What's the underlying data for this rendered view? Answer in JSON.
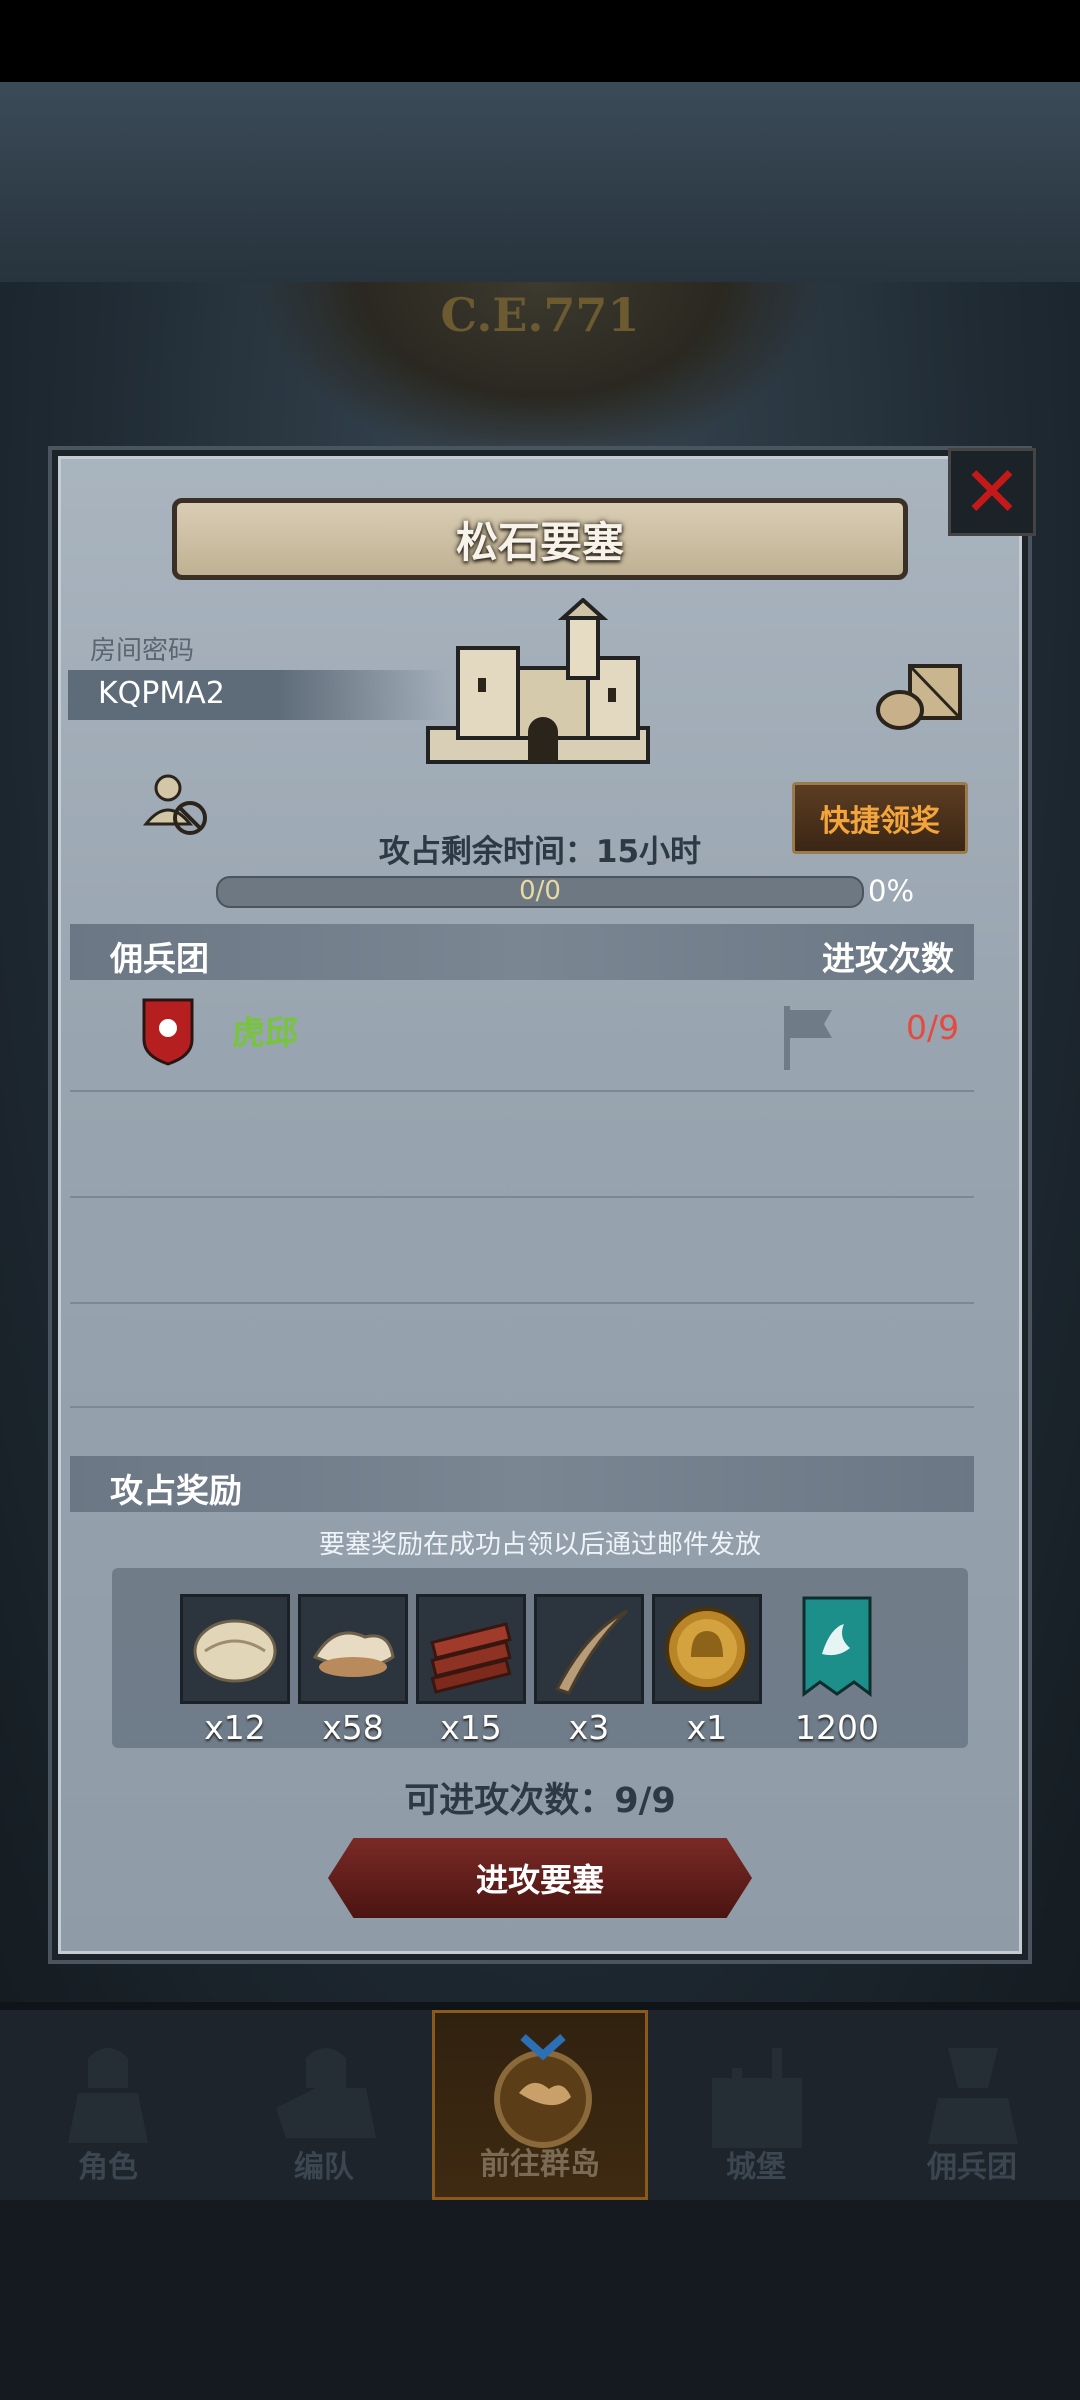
{
  "header": {
    "era_label": "C.E.771"
  },
  "dialog": {
    "title": "松石要塞",
    "room": {
      "label": "房间密码",
      "code": "KQPMA2"
    },
    "quick_claim_label": "快捷领奖",
    "remaining_time": "攻占剩余时间：15小时",
    "progress": {
      "text": "0/0",
      "percent": "0%",
      "fill": 0
    },
    "mercenary_section": {
      "title": "佣兵团",
      "attack_header": "进攻次数"
    },
    "mercenaries": [
      {
        "name": "虎邱",
        "count": "0/9"
      }
    ],
    "reward_section": {
      "title": "攻占奖励",
      "note": "要塞奖励在成功占领以后通过邮件发放"
    },
    "rewards": [
      {
        "icon": "fur-pelt-icon",
        "qty": "x12"
      },
      {
        "icon": "wool-icon",
        "qty": "x58"
      },
      {
        "icon": "wood-planks-icon",
        "qty": "x15"
      },
      {
        "icon": "horn-icon",
        "qty": "x3"
      },
      {
        "icon": "gold-helmet-coin-icon",
        "qty": "x1"
      },
      {
        "icon": "banner-icon",
        "qty": "1200"
      }
    ],
    "attack_times": "可进攻次数：9/9",
    "attack_button_label": "进攻要塞"
  },
  "nav": {
    "items": [
      {
        "label": "角色",
        "icon": "knight-icon"
      },
      {
        "label": "编队",
        "icon": "formation-icon"
      },
      {
        "label": "前往群岛",
        "icon": "islands-icon",
        "active": true
      },
      {
        "label": "城堡",
        "icon": "castle-icon"
      },
      {
        "label": "佣兵团",
        "icon": "mercenary-icon"
      }
    ]
  },
  "colors": {
    "accent_gold": "#f3a43a",
    "danger_red": "#e44a3e",
    "merc_green": "#77c43d"
  }
}
